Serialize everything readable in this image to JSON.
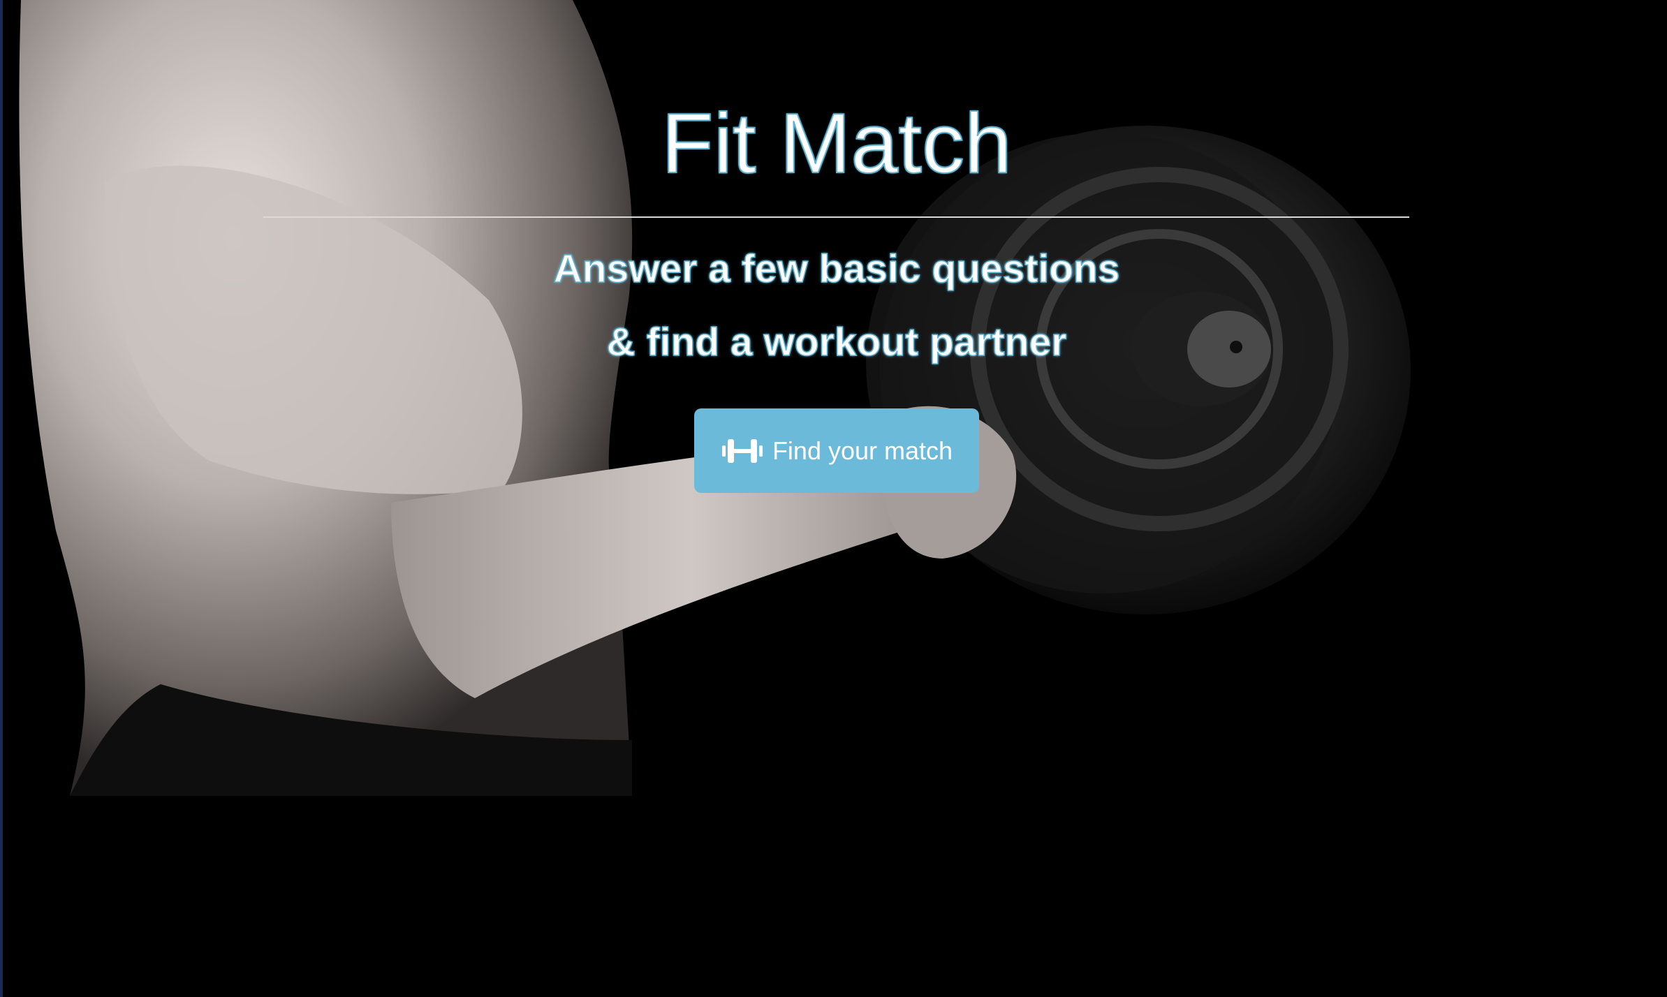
{
  "hero": {
    "title": "Fit Match",
    "subtitle_line1": "Answer a few basic questions",
    "subtitle_line2": "& find a workout partner",
    "cta_label": "Find your match",
    "cta_icon": "dumbbell-icon",
    "background_image": "muscular-arm-holding-dumbbell"
  },
  "colors": {
    "background": "#000000",
    "accent": "#6cbad9",
    "text": "#ffffff",
    "text_outline": "#5fb3d3"
  }
}
